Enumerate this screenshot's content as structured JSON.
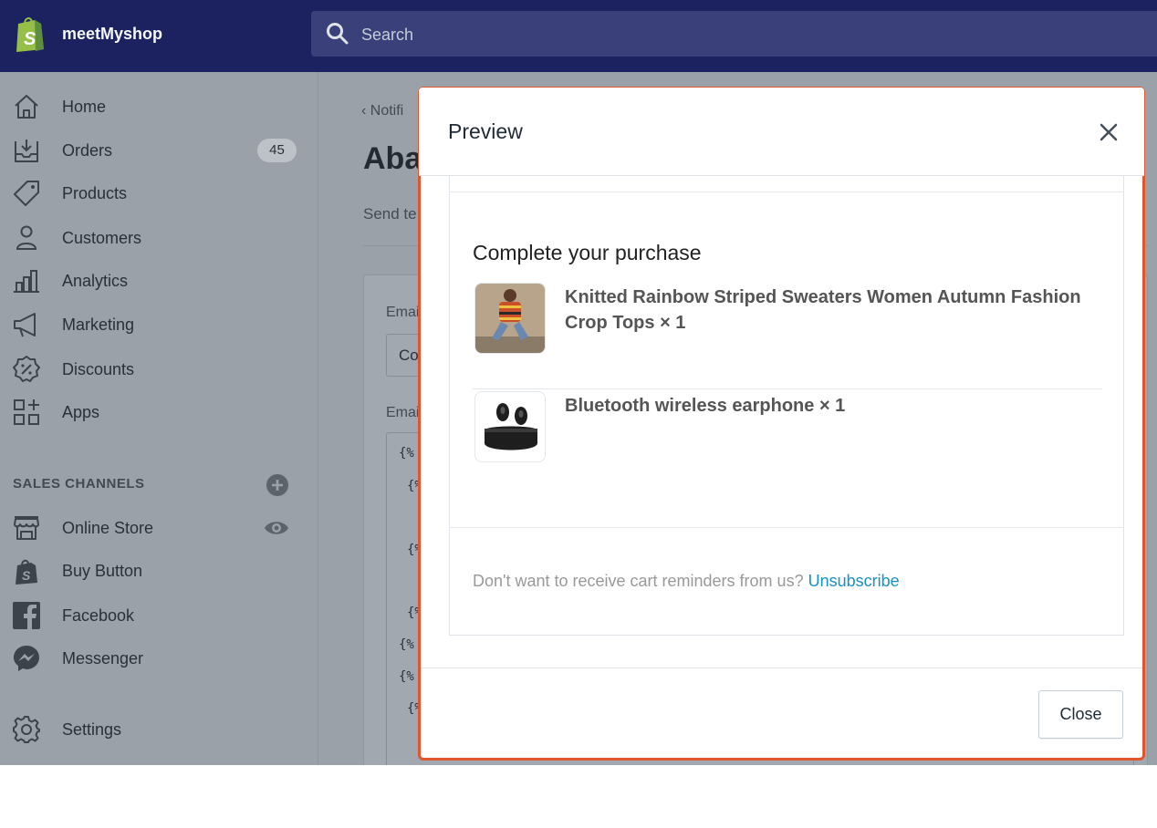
{
  "topbar": {
    "shop_name": "meetMyshop",
    "search_placeholder": "Search"
  },
  "sidebar": {
    "items": [
      {
        "label": "Home",
        "icon": "home-icon"
      },
      {
        "label": "Orders",
        "icon": "orders-icon",
        "badge": "45"
      },
      {
        "label": "Products",
        "icon": "tag-icon"
      },
      {
        "label": "Customers",
        "icon": "person-icon"
      },
      {
        "label": "Analytics",
        "icon": "bar-chart-icon"
      },
      {
        "label": "Marketing",
        "icon": "megaphone-icon"
      },
      {
        "label": "Discounts",
        "icon": "discount-icon"
      },
      {
        "label": "Apps",
        "icon": "apps-icon"
      }
    ],
    "sales_channels_label": "SALES CHANNELS",
    "channels": [
      {
        "label": "Online Store",
        "icon": "store-icon"
      },
      {
        "label": "Buy Button",
        "icon": "shopify-bag-icon"
      },
      {
        "label": "Facebook",
        "icon": "facebook-icon"
      },
      {
        "label": "Messenger",
        "icon": "messenger-icon"
      }
    ],
    "settings_label": "Settings"
  },
  "background": {
    "breadcrumb": "Notifi",
    "page_title": "Aba",
    "description": "Send te",
    "field1_label": "Emai",
    "field1_value": "Co",
    "field2_label": "Emai",
    "code_lines": [
      "{%",
      "{%",
      "",
      "{%",
      "",
      "{%",
      "{%",
      "{%",
      "{%"
    ]
  },
  "modal": {
    "title": "Preview",
    "email": {
      "heading": "Complete your purchase",
      "products": [
        {
          "name": "Knitted Rainbow Striped Sweaters Women Autumn Fashion Crop Tops × 1"
        },
        {
          "name": "Bluetooth wireless earphone × 1"
        }
      ],
      "footer_text": "Don't want to receive cart reminders from us?",
      "unsubscribe_label": "Unsubscribe"
    },
    "close_label": "Close"
  },
  "colors": {
    "topbar": "#1c2260",
    "highlight_outline": "#e1562c",
    "link": "#1990c6"
  }
}
